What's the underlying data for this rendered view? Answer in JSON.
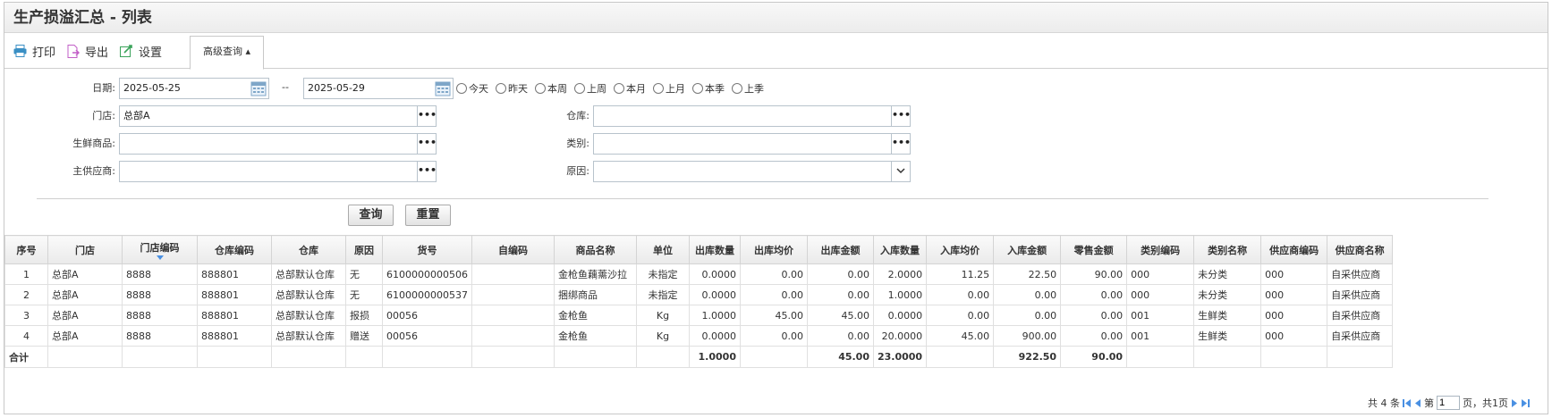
{
  "window": {
    "title": "生产损溢汇总 - 列表"
  },
  "toolbar": {
    "print_label": "打印",
    "export_label": "导出",
    "settings_label": "设置",
    "advanced_query_label": "高级查询 ▴",
    "icons": [
      "printer-icon",
      "export-icon",
      "settings-icon"
    ]
  },
  "filters": {
    "date_label": "日期:",
    "date_from": "2025-05-25",
    "date_to": "2025-05-29",
    "date_separator": "--",
    "quick_ranges": [
      "今天",
      "昨天",
      "本周",
      "上周",
      "本月",
      "上月",
      "本季",
      "上季"
    ],
    "store_label": "门店:",
    "store_value": "总部A",
    "warehouse_label": "仓库:",
    "warehouse_value": "",
    "fresh_goods_label": "生鲜商品:",
    "fresh_goods_value": "",
    "category_label": "类别:",
    "category_value": "",
    "supplier_label": "主供应商:",
    "supplier_value": "",
    "reason_label": "原因:",
    "reason_value": "",
    "ellipsis": "•••",
    "query_button": "查询",
    "reset_button": "重置"
  },
  "table": {
    "columns": [
      "序号",
      "门店",
      "门店编码",
      "仓库编码",
      "仓库",
      "原因",
      "货号",
      "自编码",
      "商品名称",
      "单位",
      "出库数量",
      "出库均价",
      "出库金额",
      "入库数量",
      "入库均价",
      "入库金额",
      "零售金额",
      "类别编码",
      "类别名称",
      "供应商编码",
      "供应商名称"
    ],
    "rows": [
      [
        "1",
        "总部A",
        "8888",
        "888801",
        "总部默认仓库",
        "无",
        "6100000000506",
        "",
        "金枪鱼藕薷沙拉",
        "未指定",
        "0.0000",
        "0.00",
        "0.00",
        "2.0000",
        "11.25",
        "22.50",
        "90.00",
        "000",
        "未分类",
        "000",
        "自采供应商"
      ],
      [
        "2",
        "总部A",
        "8888",
        "888801",
        "总部默认仓库",
        "无",
        "6100000000537",
        "",
        "捆绑商品",
        "未指定",
        "0.0000",
        "0.00",
        "0.00",
        "1.0000",
        "0.00",
        "0.00",
        "0.00",
        "000",
        "未分类",
        "000",
        "自采供应商"
      ],
      [
        "3",
        "总部A",
        "8888",
        "888801",
        "总部默认仓库",
        "报损",
        "00056",
        "",
        "金枪鱼",
        "Kg",
        "1.0000",
        "45.00",
        "45.00",
        "0.0000",
        "0.00",
        "0.00",
        "0.00",
        "001",
        "生鲜类",
        "000",
        "自采供应商"
      ],
      [
        "4",
        "总部A",
        "8888",
        "888801",
        "总部默认仓库",
        "赠送",
        "00056",
        "",
        "金枪鱼",
        "Kg",
        "0.0000",
        "0.00",
        "0.00",
        "20.0000",
        "45.00",
        "900.00",
        "0.00",
        "001",
        "生鲜类",
        "000",
        "自采供应商"
      ]
    ],
    "totals": [
      "合计",
      "",
      "",
      "",
      "",
      "",
      "",
      "",
      "",
      "",
      "1.0000",
      "",
      "45.00",
      "23.0000",
      "",
      "922.50",
      "90.00",
      "",
      "",
      "",
      ""
    ]
  },
  "pager": {
    "total_text": "共 4 条",
    "page_prefix": "第",
    "page_value": "1",
    "page_suffix": "页，共1页"
  }
}
